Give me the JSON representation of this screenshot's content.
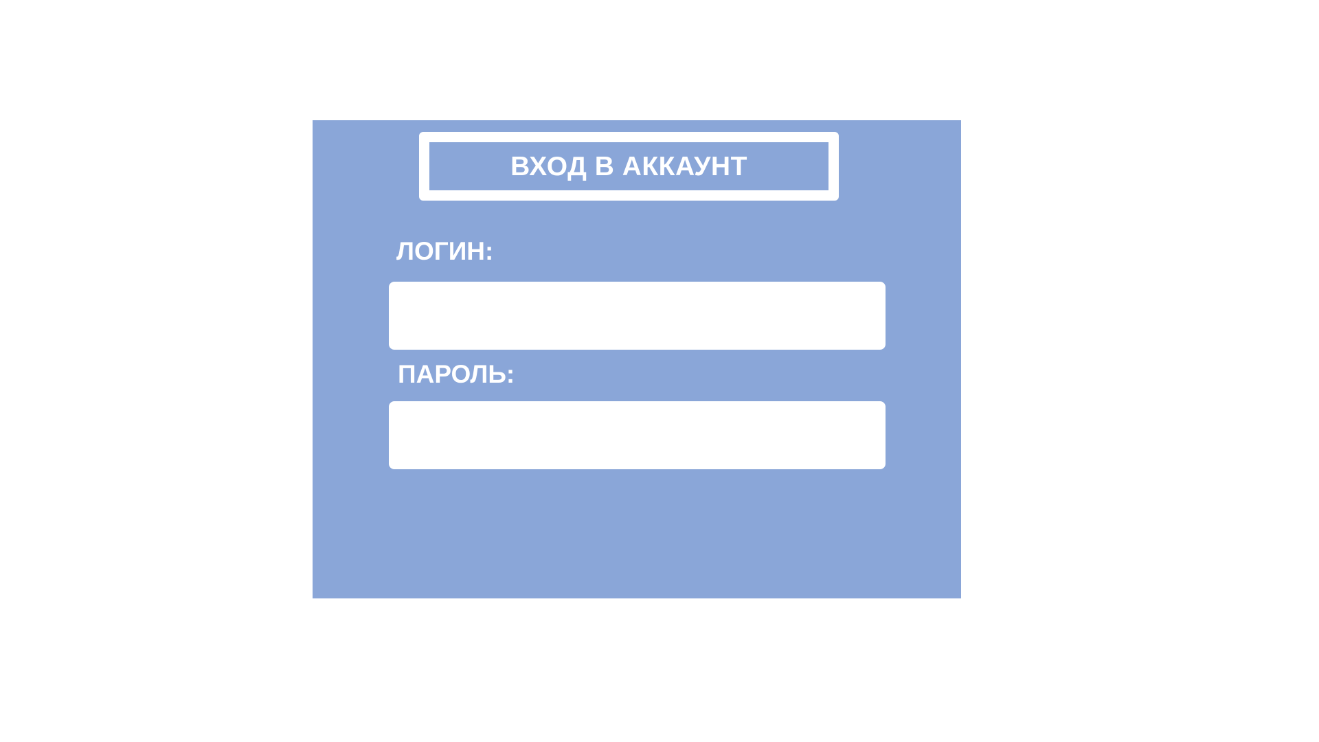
{
  "form": {
    "title": "ВХОД В АККАУНТ",
    "login": {
      "label": "ЛОГИН:",
      "value": "",
      "placeholder": ""
    },
    "password": {
      "label": "ПАРОЛЬ:",
      "value": "",
      "placeholder": ""
    }
  },
  "colors": {
    "panel_background": "#8aa6d8",
    "text": "#ffffff",
    "field_background": "#ffffff",
    "page_background": "#ffffff"
  }
}
